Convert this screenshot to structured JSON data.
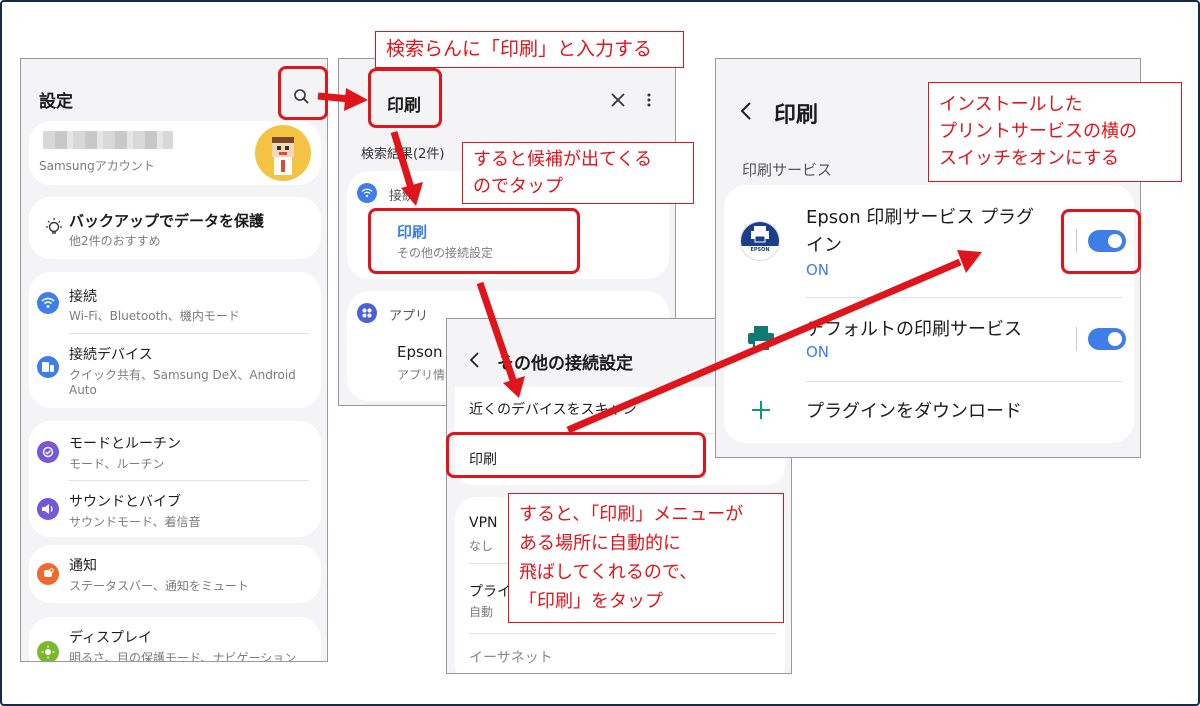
{
  "settings": {
    "title": "設定",
    "account_label": "Samsungアカウント",
    "backup": {
      "title": "バックアップでデータを保護",
      "sub": "他2件のおすすめ"
    },
    "items": [
      {
        "title": "接続",
        "sub": "Wi-Fi、Bluetooth、機内モード",
        "icon": "wifi-icon",
        "color": "#3e7ee6"
      },
      {
        "title": "接続デバイス",
        "sub": "クイック共有、Samsung DeX、Android",
        "sub2": "Auto",
        "icon": "devices-icon",
        "color": "#3e7ee6"
      },
      {
        "title": "モードとルーチン",
        "sub": "モード、ルーチン",
        "icon": "check-icon",
        "color": "#7458d9"
      },
      {
        "title": "サウンドとバイブ",
        "sub": "サウンドモード、着信音",
        "icon": "sound-icon",
        "color": "#7458d9"
      },
      {
        "title": "通知",
        "sub": "ステータスバー、通知をミュート",
        "icon": "bell-icon",
        "color": "#ef6a2f"
      },
      {
        "title": "ディスプレイ",
        "sub": "明るさ、目の保護モード、ナビゲーション",
        "icon": "sun-icon",
        "color": "#7bb82c"
      }
    ]
  },
  "search": {
    "query": "印刷",
    "results_label": "検索結果(2件)",
    "section_connect": "接続",
    "result_title": "印刷",
    "result_sub": "その他の接続設定",
    "section_apps": "アプリ",
    "app_title": "Epson",
    "app_sub": "アプリ情報"
  },
  "other": {
    "title": "その他の接続設定",
    "nearby": "近くのデバイスをスキャン",
    "print": "印刷",
    "vpn": "VPN",
    "vpn_sub": "なし",
    "private": "プライ",
    "private_sub": "自動",
    "ethernet": "イーサネット"
  },
  "print": {
    "title": "印刷",
    "section": "印刷サービス",
    "epson_line1": "Epson 印刷サービス プラグ",
    "epson_line2": "イン",
    "epson_status": "ON",
    "epson_logo": "EPSON",
    "default_title": "デフォルトの印刷サービス",
    "default_status": "ON",
    "download": "プラグインをダウンロード"
  },
  "callouts": {
    "c1": "検索らんに「印刷」と入力する",
    "c2_l1": "すると候補が出てくる",
    "c2_l2": "のでタップ",
    "c3_l1": "インストールした",
    "c3_l2": "プリントサービスの横の",
    "c3_l3": "スイッチをオンにする",
    "c4_l1": "すると、「印刷」メニューが",
    "c4_l2": "ある場所に自動的に",
    "c4_l3": "飛ばしてくれるので、",
    "c4_l4": "「印刷」をタップ"
  },
  "colors": {
    "accent": "#3e7ee6",
    "annotation_red": "#e0141b"
  }
}
